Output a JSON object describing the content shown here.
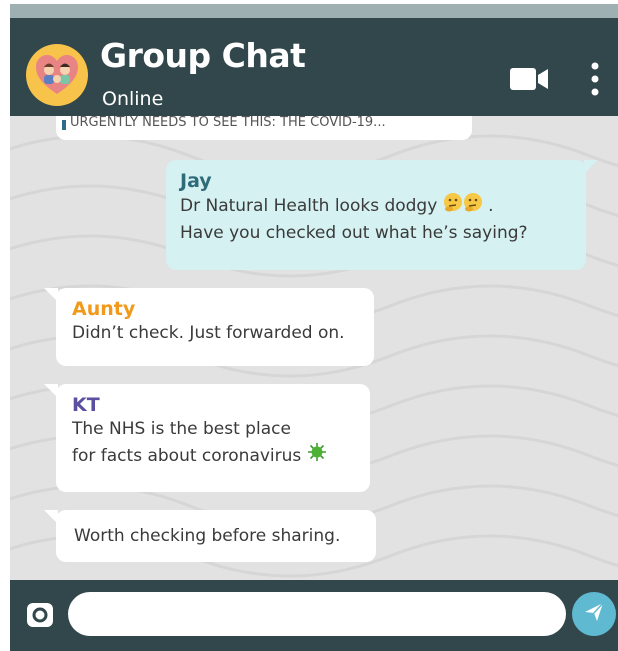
{
  "header": {
    "title": "Group Chat",
    "status": "Online",
    "avatar_icon": "family-avatar-icon",
    "video_icon": "video-camera-icon",
    "menu_icon": "more-vertical-icon"
  },
  "messages": {
    "clipped": {
      "text": "URGENTLY NEEDS TO SEE THIS: THE COVID-19..."
    },
    "jay": {
      "sender": "Jay",
      "line1": "Dr Natural Health looks dodgy",
      "line1_end": ".",
      "line2": "Have you checked out what he’s saying?",
      "emoji": "thinking-face-icon"
    },
    "aunty": {
      "sender": "Aunty",
      "line1": "Didn’t check. Just forwarded on."
    },
    "kt": {
      "sender": "KT",
      "line1": "The NHS is the best place",
      "line2": "for facts about coronavirus",
      "emoji": "virus-icon"
    },
    "extra": {
      "line1": "Worth checking before sharing."
    }
  },
  "composer": {
    "camera_icon": "camera-icon",
    "placeholder": "",
    "send_icon": "send-icon"
  },
  "colors": {
    "header_bg": "#31474b",
    "chat_bg": "#e2e2e2",
    "outgoing_bubble": "#d5f1f1",
    "accent": "#5fb9d1",
    "aunty_name": "#f0991a",
    "kt_name": "#5a4fa0",
    "jay_name": "#2f6c7a"
  }
}
